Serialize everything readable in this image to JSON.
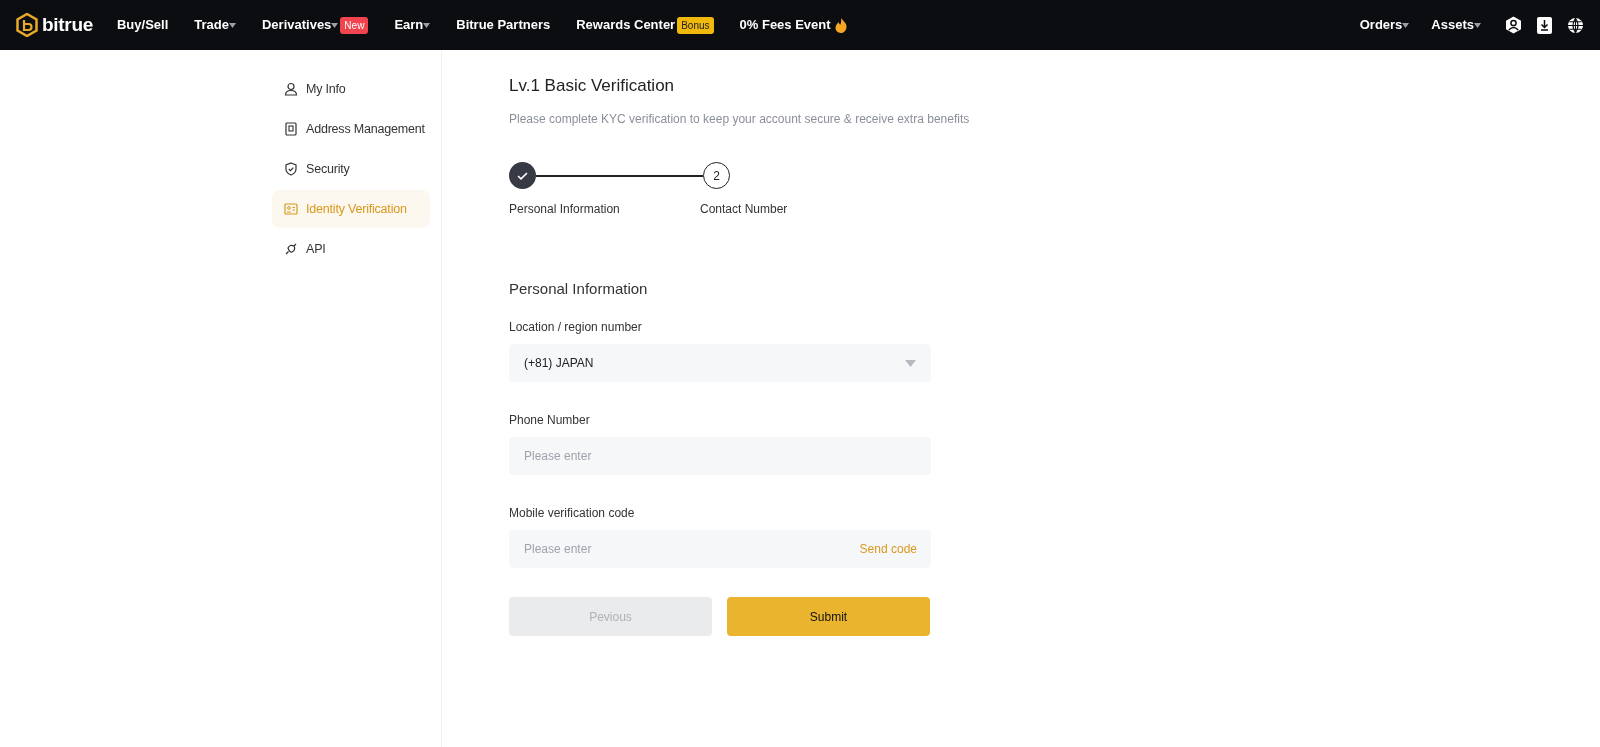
{
  "brand": {
    "name": "bitrue"
  },
  "nav": {
    "items": [
      {
        "label": "Buy/Sell",
        "dropdown": false
      },
      {
        "label": "Trade",
        "dropdown": true
      },
      {
        "label": "Derivatives",
        "dropdown": true,
        "badge": {
          "text": "New",
          "color": "#f0444f"
        }
      },
      {
        "label": "Earn",
        "dropdown": true
      },
      {
        "label": "Bitrue Partners",
        "dropdown": false
      },
      {
        "label": "Rewards Center",
        "dropdown": false,
        "badge": {
          "text": "Bonus",
          "color": "#f0b90b"
        }
      },
      {
        "label": "0% Fees Event",
        "dropdown": false,
        "emoji": true
      }
    ],
    "right_items": [
      {
        "label": "Orders",
        "dropdown": true
      },
      {
        "label": "Assets",
        "dropdown": true
      }
    ]
  },
  "sidebar": {
    "items": [
      {
        "label": "My Info",
        "selected": false
      },
      {
        "label": "Address Management",
        "selected": false
      },
      {
        "label": "Security",
        "selected": false
      },
      {
        "label": "Identity Verification",
        "selected": true
      },
      {
        "label": "API",
        "selected": false
      }
    ]
  },
  "page": {
    "title": "Lv.1 Basic Verification",
    "subtitle": "Please complete KYC verification to keep your account secure & receive extra benefits"
  },
  "stepper": {
    "steps": [
      {
        "label": "Personal Information",
        "done": true
      },
      {
        "label": "Contact Number",
        "number": "2",
        "done": false
      }
    ]
  },
  "form": {
    "title": "Personal Information",
    "fields": [
      {
        "kind": "select",
        "label": "Location / region number",
        "value": "(+81) JAPAN"
      },
      {
        "kind": "input",
        "label": "Phone Number",
        "placeholder": "Please enter"
      },
      {
        "kind": "code",
        "label": "Mobile verification code",
        "placeholder": "Please enter",
        "action": "Send code"
      }
    ],
    "buttons": [
      {
        "label": "Pevious",
        "disabled": true
      },
      {
        "label": "Submit",
        "disabled": false
      }
    ]
  }
}
